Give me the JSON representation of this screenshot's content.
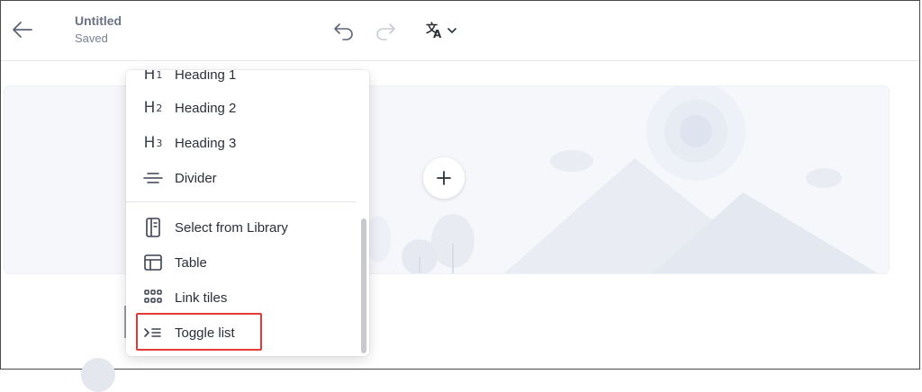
{
  "header": {
    "title": "Untitled",
    "status": "Saved",
    "back_icon": "arrow-left-icon",
    "undo_icon": "undo-icon",
    "redo_icon": "redo-icon",
    "translate_icon": "translate-icon"
  },
  "menu": {
    "items": [
      {
        "label": "Heading 1",
        "icon": "heading-1-icon"
      },
      {
        "label": "Heading 2",
        "icon": "heading-2-icon"
      },
      {
        "label": "Heading 3",
        "icon": "heading-3-icon"
      },
      {
        "label": "Divider",
        "icon": "divider-icon"
      },
      {
        "label": "Select from Library",
        "icon": "library-icon"
      },
      {
        "label": "Table",
        "icon": "table-icon"
      },
      {
        "label": "Link tiles",
        "icon": "grid-icon"
      },
      {
        "label": "Toggle list",
        "icon": "toggle-list-icon"
      }
    ]
  },
  "colors": {
    "accent_highlight": "#e53935",
    "banner_bg": "#f6f7fb"
  }
}
